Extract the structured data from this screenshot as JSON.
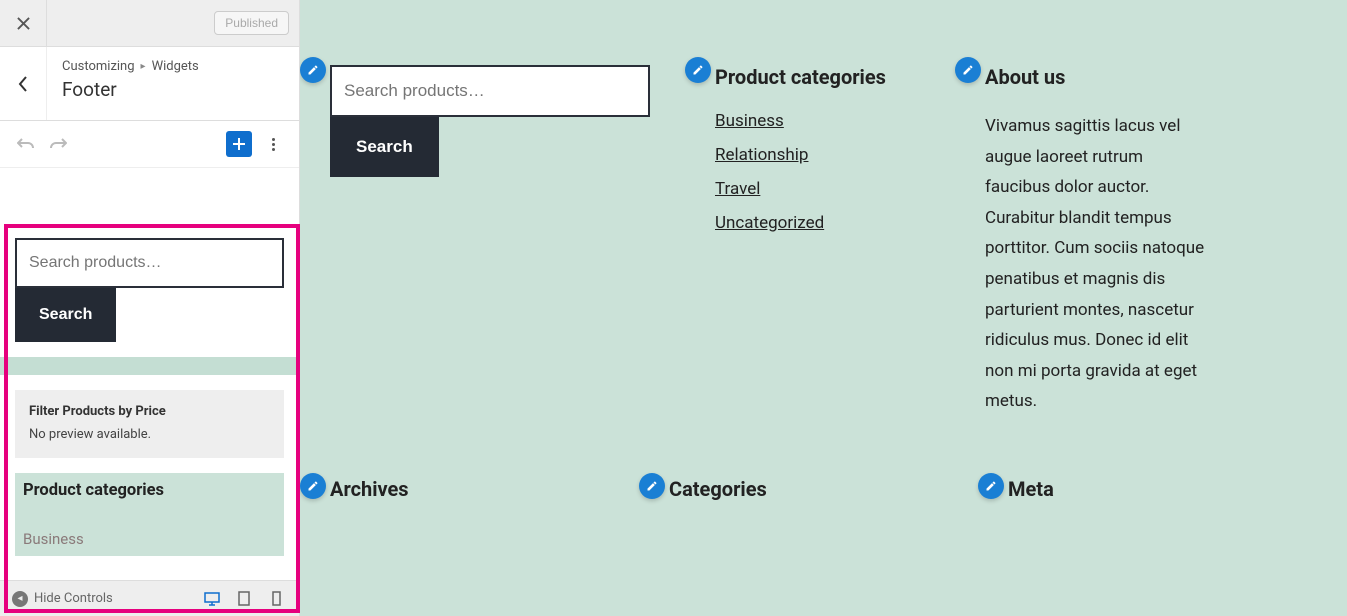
{
  "top": {
    "published": "Published"
  },
  "crumb": {
    "customizing": "Customizing",
    "widgets": "Widgets",
    "title": "Footer"
  },
  "sidebar_blocks": {
    "search_placeholder": "Search products…",
    "search_btn": "Search",
    "filter_title": "Filter Products by Price",
    "filter_msg": "No preview available.",
    "cat_heading": "Product categories",
    "cat_item": "Business"
  },
  "bottom": {
    "hide": "Hide Controls"
  },
  "preview": {
    "search_placeholder": "Search products…",
    "search_btn": "Search",
    "cat_heading": "Product categories",
    "cats": [
      "Business",
      "Relationship",
      "Travel",
      "Uncategorized"
    ],
    "about_heading": "About us",
    "about_text": "Vivamus sagittis lacus vel augue laoreet rutrum faucibus dolor auctor. Curabitur blandit tempus porttitor. Cum sociis natoque penatibus et magnis dis parturient montes, nascetur ridiculus mus. Donec id elit non mi porta gravida at eget metus.",
    "row2": [
      "Archives",
      "Categories",
      "Meta"
    ]
  }
}
